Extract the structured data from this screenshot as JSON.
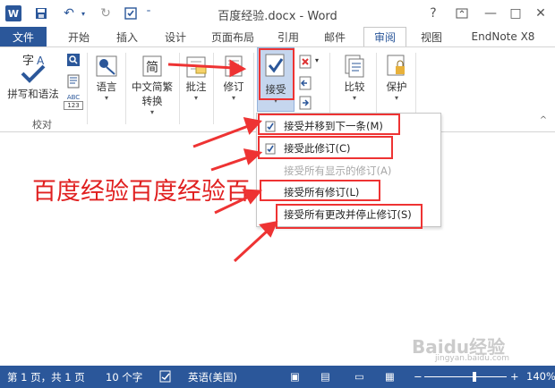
{
  "titlebar": {
    "app_icon": "W",
    "document_title": "百度经验.docx - Word",
    "help": "?",
    "minimize": "—",
    "restore": "□",
    "close": "✕"
  },
  "tabs": [
    "文件",
    "开始",
    "插入",
    "设计",
    "页面布局",
    "引用",
    "邮件",
    "审阅",
    "视图",
    "EndNote X8"
  ],
  "active_tab": "审阅",
  "ribbon": {
    "spelling_label": "拼写和语法",
    "group_proofing": "校对",
    "language_label": "语言",
    "chinese_conv_line1": "中文简繁",
    "chinese_conv_line2": "转换",
    "comments_label": "批注",
    "track_label": "修订",
    "accept_label": "接受",
    "compare_label": "比较",
    "protect_label": "保护",
    "abc_label": "ABC",
    "num_label": "123"
  },
  "accept_menu": {
    "items": [
      {
        "label": "接受并移到下一条(M)",
        "enabled": true
      },
      {
        "label": "接受此修订(C)",
        "enabled": true
      },
      {
        "label": "接受所有显示的修订(A)",
        "enabled": false
      },
      {
        "label": "接受所有修订(L)",
        "enabled": true
      },
      {
        "label": "接受所有更改并停止修订(S)",
        "enabled": true
      }
    ]
  },
  "document": {
    "text": "百度经验百度经验百"
  },
  "statusbar": {
    "page": "第 1 页，共 1 页",
    "words": "10 个字",
    "language": "英语(美国)",
    "zoom": "140%"
  },
  "watermark": {
    "brand": "Baidu经验",
    "url": "jingyan.baidu.com"
  },
  "colors": {
    "accent": "#2b579a",
    "annotation_red": "#e33333"
  }
}
